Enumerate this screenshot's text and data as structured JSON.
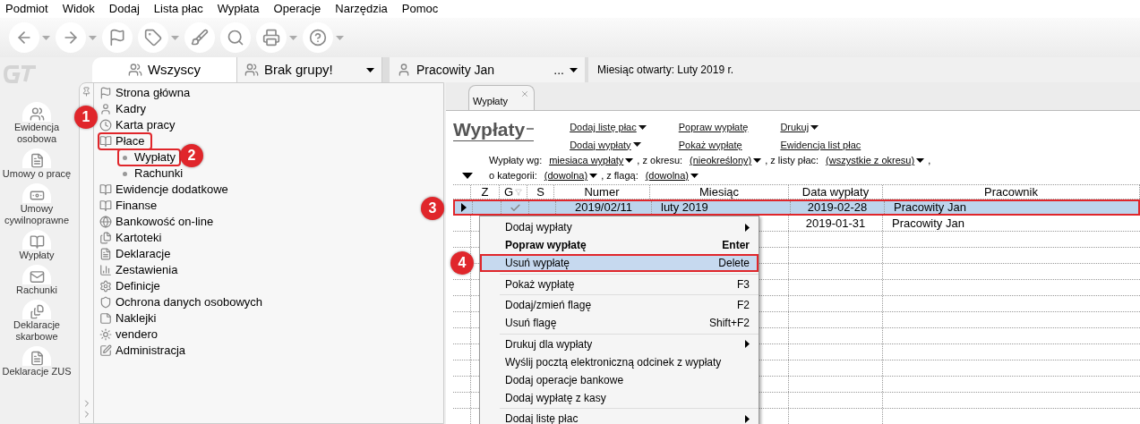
{
  "menu_bar": [
    "Podmiot",
    "Widok",
    "Dodaj",
    "Lista płac",
    "Wypłata",
    "Operacje",
    "Narzędzia",
    "Pomoc"
  ],
  "toolbar": [
    {
      "kind": "back",
      "dropdown": true
    },
    {
      "kind": "forward",
      "dropdown": true
    },
    {
      "kind": "flag",
      "dropdown": false
    },
    {
      "kind": "tag",
      "dropdown": true
    },
    {
      "kind": "brush",
      "dropdown": false
    },
    {
      "kind": "search",
      "dropdown": false
    },
    {
      "kind": "printer",
      "dropdown": true
    },
    {
      "kind": "help",
      "dropdown": true
    }
  ],
  "sidebar": {
    "items": [
      {
        "label": "Ewidencja osobowa",
        "kind": "people"
      },
      {
        "label": "Umowy o pracę",
        "kind": "contract"
      },
      {
        "label": "Umowy cywilnoprawne",
        "kind": "money"
      },
      {
        "label": "Wypłaty",
        "kind": "payout"
      },
      {
        "label": "Rachunki",
        "kind": "mail"
      },
      {
        "label": "Deklaracje skarbowe",
        "kind": "doc"
      },
      {
        "label": "Deklaracje ZUS",
        "kind": "zus"
      }
    ]
  },
  "group_tabs": [
    {
      "label": "Wszyscy",
      "selected": true,
      "dropdown": false
    },
    {
      "label": "Brak grupy!",
      "selected": false,
      "dropdown": true
    }
  ],
  "employee_selector": {
    "value": "Pracowity Jan",
    "more": "..."
  },
  "open_month": "Miesiąc otwarty: Luty 2019 r.",
  "tree": {
    "items": [
      {
        "label": "Strona główna",
        "kind": "flag",
        "outlined": false
      },
      {
        "label": "Kadry",
        "kind": "person",
        "outlined": false
      },
      {
        "label": "Karta pracy",
        "kind": "clock",
        "outlined": false
      },
      {
        "label": "Płace",
        "kind": "book",
        "outlined": true,
        "children": [
          {
            "label": "Wypłaty",
            "outlined": true
          },
          {
            "label": "Rachunki",
            "outlined": false
          }
        ]
      },
      {
        "label": "Ewidencje dodatkowe",
        "kind": "book",
        "outlined": false
      },
      {
        "label": "Finanse",
        "kind": "book",
        "outlined": false
      },
      {
        "label": "Bankowość on-line",
        "kind": "globe",
        "outlined": false
      },
      {
        "label": "Kartoteki",
        "kind": "files",
        "outlined": false
      },
      {
        "label": "Deklaracje",
        "kind": "doc",
        "outlined": false
      },
      {
        "label": "Zestawienia",
        "kind": "chart",
        "outlined": false
      },
      {
        "label": "Definicje",
        "kind": "settings",
        "outlined": false
      },
      {
        "label": "Ochrona danych osobowych",
        "kind": "shield",
        "outlined": false
      },
      {
        "label": "Naklejki",
        "kind": "sticker",
        "outlined": false
      },
      {
        "label": "vendero",
        "kind": "sun",
        "outlined": false
      },
      {
        "label": "Administracja",
        "kind": "edit",
        "outlined": false
      }
    ]
  },
  "document_tabs": [
    {
      "label": "Wypłaty",
      "selected": true
    }
  ],
  "view": {
    "title": "Wypłaty",
    "actions": [
      [
        {
          "label": "Dodaj listę płac",
          "dropdown": true
        },
        {
          "label": "Dodaj wypłaty",
          "dropdown": true
        }
      ],
      [
        {
          "label": "Popraw wypłatę",
          "dropdown": false
        },
        {
          "label": "Pokaż wypłatę",
          "dropdown": false
        }
      ],
      [
        {
          "label": "Drukuj",
          "dropdown": true
        },
        {
          "label": "Ewidencja list płac",
          "dropdown": false
        }
      ]
    ]
  },
  "filters": [
    [
      {
        "kind": "text",
        "text": "Wypłaty wg:"
      },
      {
        "kind": "link",
        "text": "miesiaca wypłaty"
      },
      {
        "kind": "text",
        "text": ", z okresu:"
      },
      {
        "kind": "link",
        "text": "(nieokreślony)"
      },
      {
        "kind": "text",
        "text": ", z listy płac:"
      },
      {
        "kind": "link",
        "text": "(wszystkie z okresu)"
      },
      {
        "kind": "text",
        "text": ","
      }
    ],
    [
      {
        "kind": "text",
        "text": "o kategorii:"
      },
      {
        "kind": "link",
        "text": "(dowolna)"
      },
      {
        "kind": "text",
        "text": ", z flagą:"
      },
      {
        "kind": "link",
        "text": "(dowolna)"
      }
    ]
  ],
  "table": {
    "columns": [
      {
        "label": "Z",
        "filter": false
      },
      {
        "label": "G",
        "filter": true
      },
      {
        "label": "S",
        "filter": false
      },
      {
        "label": "Numer",
        "filter": false
      },
      {
        "label": "Miesiąc",
        "filter": false
      },
      {
        "label": "Data wypłaty",
        "filter": false
      },
      {
        "label": "Pracownik",
        "filter": false
      }
    ],
    "rows": [
      {
        "selected": true,
        "outlined": true,
        "g_checked": true,
        "numer": "2019/02/11",
        "miesiac": "luty 2019",
        "data": "2019-02-28",
        "pracownik": "Pracowity Jan"
      },
      {
        "selected": false,
        "outlined": false,
        "data": "2019-01-31",
        "pracownik": "Pracowity Jan"
      }
    ]
  },
  "context_menu": [
    {
      "kind": "item",
      "label": "Dodaj wypłaty",
      "submenu": true,
      "bold": false,
      "highlighted": false,
      "outlined": false
    },
    {
      "kind": "item",
      "label": "Popraw wypłatę",
      "shortcut": "Enter",
      "submenu": false,
      "bold": true,
      "highlighted": false,
      "outlined": false
    },
    {
      "kind": "item",
      "label": "Usuń wypłatę",
      "shortcut": "Delete",
      "submenu": false,
      "bold": false,
      "highlighted": true,
      "outlined": true
    },
    {
      "kind": "separator"
    },
    {
      "kind": "item",
      "label": "Pokaż wypłatę",
      "shortcut": "F3",
      "submenu": false,
      "bold": false,
      "highlighted": false,
      "outlined": false
    },
    {
      "kind": "separator"
    },
    {
      "kind": "item",
      "label": "Dodaj/zmień flagę",
      "shortcut": "F2",
      "submenu": false,
      "bold": false,
      "highlighted": false,
      "outlined": false
    },
    {
      "kind": "item",
      "label": "Usuń flagę",
      "shortcut": "Shift+F2",
      "submenu": false,
      "bold": false,
      "highlighted": false,
      "outlined": false
    },
    {
      "kind": "separator"
    },
    {
      "kind": "item",
      "label": "Drukuj dla wypłaty",
      "submenu": true,
      "bold": false,
      "highlighted": false,
      "outlined": false
    },
    {
      "kind": "item",
      "label": "Wyślij pocztą elektroniczną odcinek z wypłaty",
      "submenu": false,
      "bold": false,
      "highlighted": false,
      "outlined": false
    },
    {
      "kind": "item",
      "label": "Dodaj operacje bankowe",
      "submenu": false,
      "bold": false,
      "highlighted": false,
      "outlined": false
    },
    {
      "kind": "item",
      "label": "Dodaj wypłatę z kasy",
      "submenu": false,
      "bold": false,
      "highlighted": false,
      "outlined": false
    },
    {
      "kind": "separator"
    },
    {
      "kind": "item",
      "label": "Dodaj listę płac",
      "submenu": true,
      "bold": false,
      "highlighted": false,
      "outlined": false
    }
  ],
  "annotations": [
    {
      "label": "1"
    },
    {
      "label": "2"
    },
    {
      "label": "3"
    },
    {
      "label": "4"
    }
  ]
}
